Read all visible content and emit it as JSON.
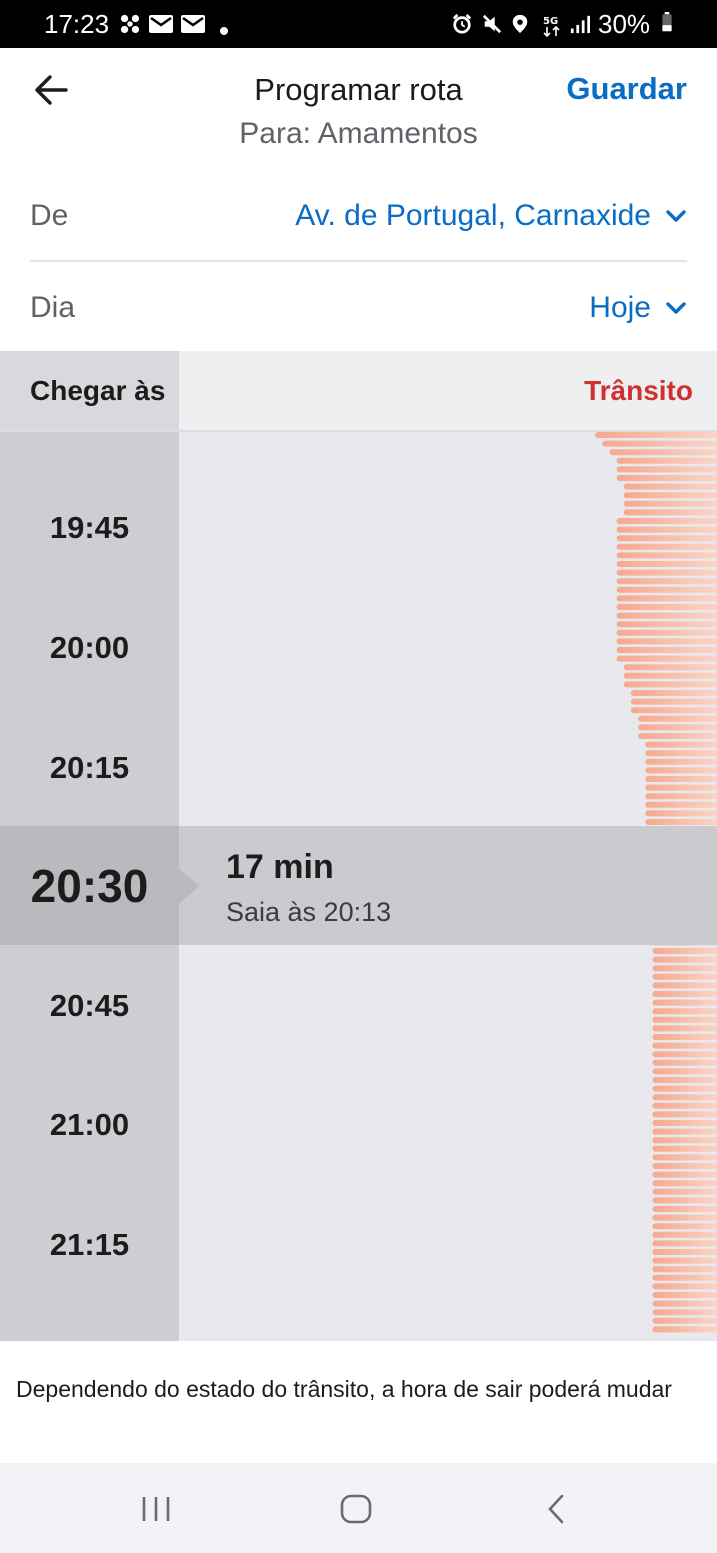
{
  "status_bar": {
    "time": "17:23",
    "battery": "30%",
    "icons": [
      "fan-icon",
      "mail-icon",
      "mail-icon",
      "dot-icon",
      "alarm-icon",
      "mute-icon",
      "location-icon",
      "5g-icon",
      "signal-icon",
      "battery-icon"
    ]
  },
  "header": {
    "title": "Programar rota",
    "subtitle": "Para: Amamentos",
    "save_label": "Guardar"
  },
  "from": {
    "label": "De",
    "value": "Av. de Portugal, Carnaxide"
  },
  "day": {
    "label": "Dia",
    "value": "Hoje"
  },
  "timeline": {
    "arrive_label": "Chegar às",
    "traffic_label": "Trânsito",
    "slots": [
      "19:45",
      "20:00",
      "20:15",
      "20:45",
      "21:00",
      "21:15"
    ],
    "selected": {
      "time": "20:30",
      "duration": "17 min",
      "leave": "Saia às 20:13"
    },
    "traffic_levels": [
      0.17,
      0.16,
      0.15,
      0.14,
      0.14,
      0.14,
      0.13,
      0.13,
      0.13,
      0.13,
      0.14,
      0.14,
      0.14,
      0.14,
      0.14,
      0.14,
      0.14,
      0.14,
      0.14,
      0.14,
      0.14,
      0.14,
      0.14,
      0.14,
      0.14,
      0.14,
      0.14,
      0.13,
      0.13,
      0.13,
      0.12,
      0.12,
      0.12,
      0.11,
      0.11,
      0.11,
      0.1,
      0.1,
      0.1,
      0.1,
      0.1,
      0.1,
      0.1,
      0.1,
      0.1,
      0.1,
      0.11,
      0.11,
      0.11,
      0.11,
      0.11,
      0.11,
      0.1,
      0.1,
      0.1,
      0.09,
      0.09,
      0.09,
      0.09,
      0.09,
      0.09,
      0.09,
      0.09,
      0.09,
      0.09,
      0.09,
      0.09,
      0.09,
      0.09,
      0.09,
      0.09,
      0.09,
      0.09,
      0.09,
      0.09,
      0.09,
      0.09,
      0.09,
      0.09,
      0.09,
      0.09,
      0.09,
      0.09,
      0.09,
      0.09,
      0.09,
      0.09,
      0.09,
      0.09,
      0.09,
      0.09,
      0.09,
      0.09,
      0.09,
      0.09,
      0.09,
      0.09,
      0.09,
      0.09,
      0.09,
      0.09,
      0.09,
      0.09,
      0.09,
      0.09
    ]
  },
  "note": "Dependendo do estado do trânsito, a hora de sair poderá mudar",
  "nav_bar": {
    "icons": [
      "recents-icon",
      "home-icon",
      "back-nav-icon"
    ]
  },
  "colors": {
    "accent": "#0a6cc4",
    "traffic": "#d32f2f",
    "traffic_bar": "#f7a88f"
  }
}
